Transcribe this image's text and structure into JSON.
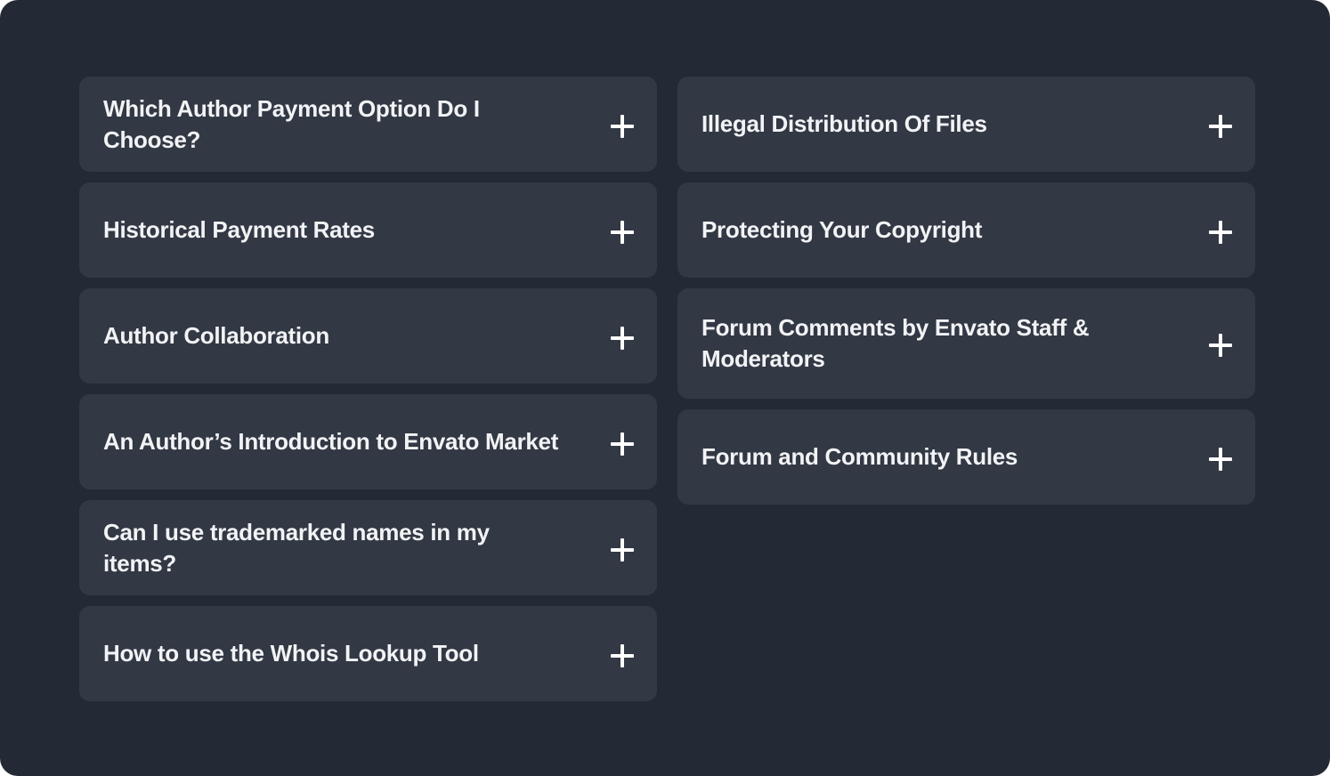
{
  "faq": {
    "left": [
      {
        "title": "Which Author Payment Option Do I Choose?",
        "icon": "plus-icon"
      },
      {
        "title": "Historical Payment Rates",
        "icon": "plus-icon"
      },
      {
        "title": "Author Collaboration",
        "icon": "plus-icon"
      },
      {
        "title": "An Author’s Introduction to Envato Market",
        "icon": "plus-icon"
      },
      {
        "title": "Can I use trademarked names in my items?",
        "icon": "plus-icon"
      },
      {
        "title": "How to use the Whois Lookup Tool",
        "icon": "plus-icon"
      }
    ],
    "right": [
      {
        "title": "Illegal Distribution Of Files",
        "icon": "plus-icon"
      },
      {
        "title": "Protecting Your Copyright",
        "icon": "plus-icon"
      },
      {
        "title": "Forum Comments by Envato Staff & Moderators",
        "icon": "plus-icon"
      },
      {
        "title": "Forum and Community Rules",
        "icon": "plus-icon"
      }
    ]
  },
  "colors": {
    "background": "#232a35",
    "card": "#323844",
    "text": "#f2f3f5",
    "icon": "#ffffff"
  }
}
